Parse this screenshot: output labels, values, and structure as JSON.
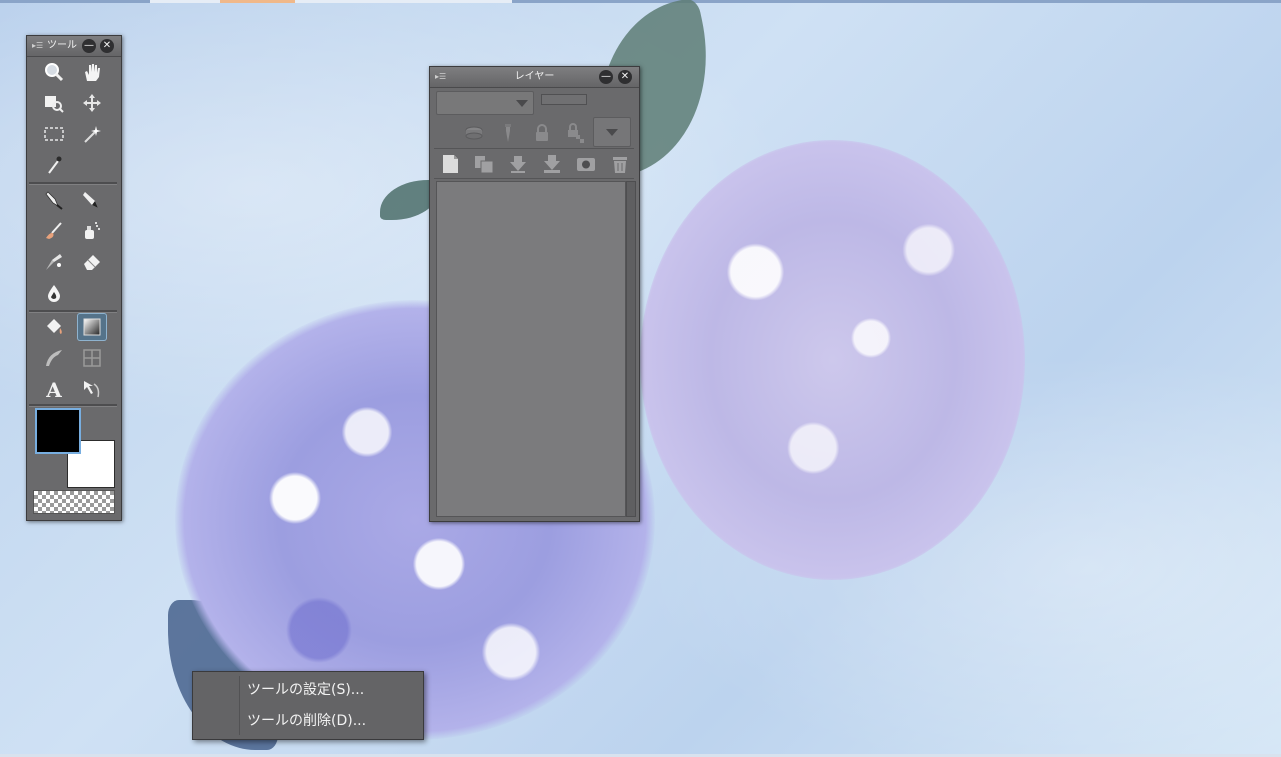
{
  "tool_palette": {
    "title": "ツール",
    "tools": [
      {
        "id": "zoom",
        "icon": "magnifier-icon"
      },
      {
        "id": "hand",
        "icon": "hand-icon"
      },
      {
        "id": "operation",
        "icon": "object-select-icon"
      },
      {
        "id": "move-layer",
        "icon": "move-layer-icon"
      },
      {
        "id": "selection",
        "icon": "rect-selection-icon"
      },
      {
        "id": "auto-select",
        "icon": "magic-wand-icon"
      },
      {
        "id": "eyedropper",
        "icon": "eyedropper-icon"
      },
      {
        "id": "pen",
        "icon": "pen-nib-icon"
      },
      {
        "id": "pencil",
        "icon": "pencil-icon"
      },
      {
        "id": "brush",
        "icon": "brush-icon"
      },
      {
        "id": "airbrush",
        "icon": "airbrush-icon"
      },
      {
        "id": "decoration",
        "icon": "decoration-icon"
      },
      {
        "id": "eraser",
        "icon": "eraser-icon"
      },
      {
        "id": "blend",
        "icon": "blend-drop-icon"
      },
      {
        "id": "fill",
        "icon": "fill-bucket-icon"
      },
      {
        "id": "gradient",
        "icon": "gradient-icon",
        "selected": true
      },
      {
        "id": "figure",
        "icon": "figure-curve-icon"
      },
      {
        "id": "frame",
        "icon": "frame-border-icon"
      },
      {
        "id": "text",
        "icon": "text-icon"
      },
      {
        "id": "correct-line",
        "icon": "correct-line-icon"
      }
    ],
    "main_color": "#000000",
    "sub_color": "#ffffff"
  },
  "layer_palette": {
    "title": "レイヤー",
    "blend_mode": "",
    "opacity": "",
    "row1_icons": [
      "reference-layer-icon",
      "draft-layer-icon",
      "lock-icon",
      "lock-transparent-icon"
    ],
    "row2_icons": [
      "new-raster-layer-icon",
      "new-folder-icon",
      "merge-down-icon",
      "merge-visible-icon",
      "mask-icon",
      "trash-icon"
    ]
  },
  "context_menu": {
    "items": [
      {
        "label": "ツールの設定(S)..."
      },
      {
        "label": "ツールの削除(D)..."
      }
    ]
  },
  "theme": {
    "panel_bg": "#6a6a6c",
    "accent": "#78aee0",
    "menu_text": "#f2f2f2"
  }
}
